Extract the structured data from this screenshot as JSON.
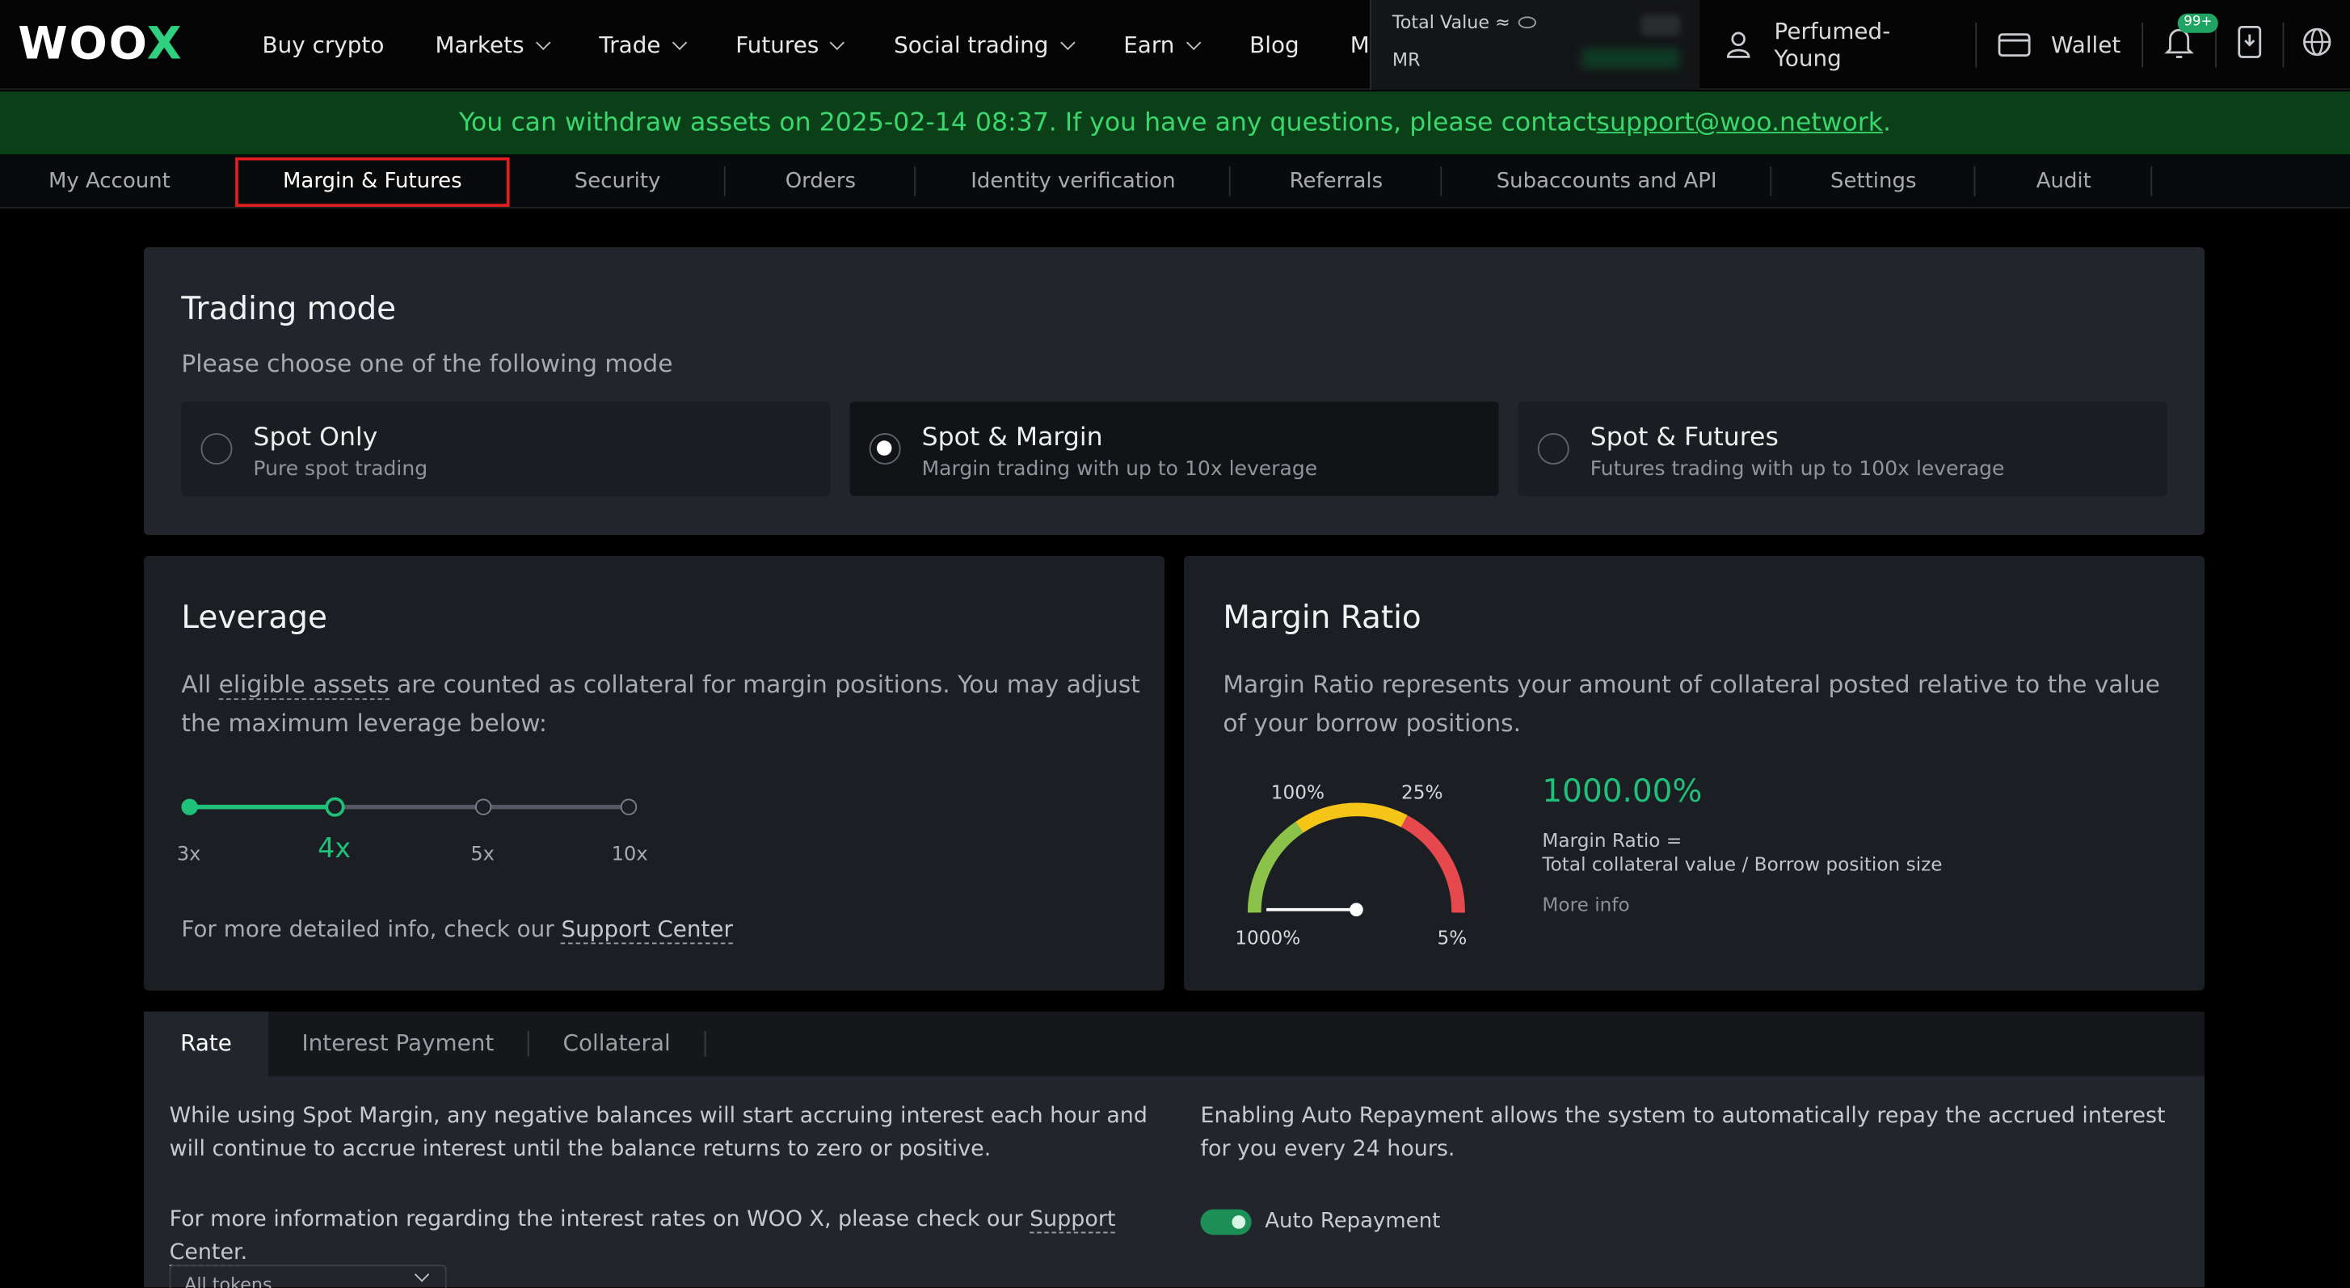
{
  "logo": {
    "text_a": "WOO",
    "text_b": "X"
  },
  "nav": [
    {
      "label": "Buy crypto",
      "dropdown": false
    },
    {
      "label": "Markets",
      "dropdown": true
    },
    {
      "label": "Trade",
      "dropdown": true
    },
    {
      "label": "Futures",
      "dropdown": true
    },
    {
      "label": "Social trading",
      "dropdown": true
    },
    {
      "label": "Earn",
      "dropdown": true
    },
    {
      "label": "Blog",
      "dropdown": false
    },
    {
      "label": "Mo",
      "dropdown": false
    }
  ],
  "total_value": {
    "label": "Total Value ≈",
    "mr_label": "MR"
  },
  "user": {
    "name": "Perfumed-Young",
    "wallet": "Wallet",
    "notif_badge": "99+"
  },
  "banner": {
    "text": "You can withdraw assets on 2025-02-14 08:37. If you have any questions, please contact ",
    "email": "support@woo.network",
    "end": "."
  },
  "account_tabs": [
    "My Account",
    "Margin & Futures",
    "Security",
    "Orders",
    "Identity verification",
    "Referrals",
    "Subaccounts and API",
    "Settings",
    "Audit"
  ],
  "trading_mode": {
    "title": "Trading mode",
    "subtitle": "Please choose one of the following mode",
    "options": [
      {
        "title": "Spot Only",
        "desc": "Pure spot trading",
        "selected": false
      },
      {
        "title": "Spot & Margin",
        "desc": "Margin trading with up to 10x leverage",
        "selected": true
      },
      {
        "title": "Spot & Futures",
        "desc": "Futures trading with up to 100x leverage",
        "selected": false
      }
    ]
  },
  "leverage": {
    "title": "Leverage",
    "desc_a": "All ",
    "desc_link": "eligible assets",
    "desc_b": " are counted as collateral for margin positions. You may adjust the maximum leverage below:",
    "ticks": [
      "3x",
      "4x",
      "5x",
      "10x"
    ],
    "current": "4x",
    "current_index": 1,
    "footer": "For more detailed info, check our ",
    "footer_link": "Support Center"
  },
  "margin_ratio": {
    "title": "Margin Ratio",
    "desc": "Margin Ratio represents your amount of collateral posted relative to the value of your borrow positions.",
    "value": "1000.00%",
    "formula_a": "Margin Ratio =",
    "formula_b": "Total collateral value / Borrow position size",
    "more_info": "More info",
    "gauge_labels": {
      "tl": "100%",
      "tr": "25%",
      "bl": "1000%",
      "br": "5%"
    },
    "colors": {
      "green": "#8bc34a",
      "yellow": "#f5c518",
      "red": "#e5484d"
    }
  },
  "bottom": {
    "tabs": [
      "Rate",
      "Interest Payment",
      "Collateral"
    ],
    "left_text": "While using Spot Margin, any negative balances will start accruing interest each hour and will continue to accrue interest until the balance returns to zero or positive.",
    "left_more": "For more information regarding the interest rates on WOO X, please check our ",
    "left_link": "Support Center",
    "left_end": ".",
    "right_text": "Enabling Auto Repayment allows the system to automatically repay the accrued interest for you every 24 hours.",
    "toggle_label": "Auto Repayment",
    "select_value": "All tokens"
  },
  "colors": {
    "accent": "#2fd07f",
    "banner_bg": "#0b3f18",
    "card": "#22262c"
  }
}
